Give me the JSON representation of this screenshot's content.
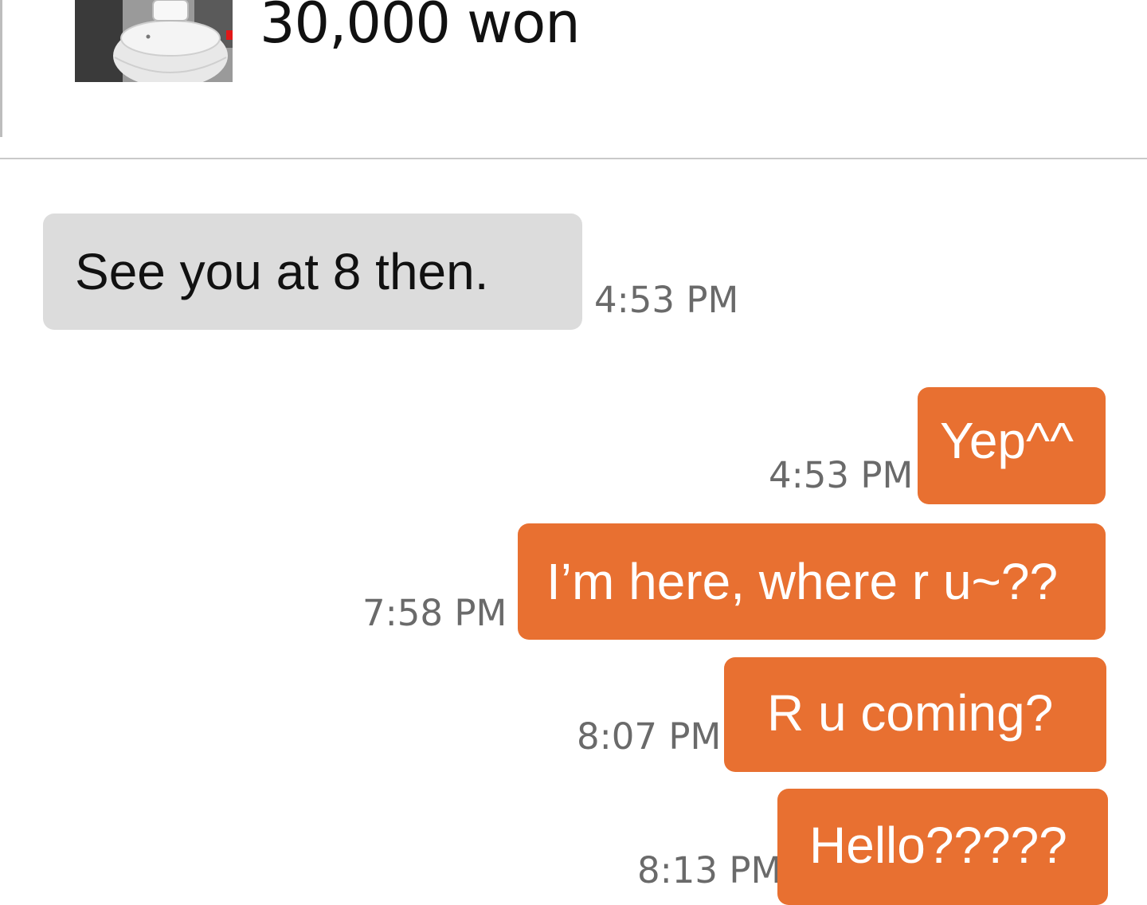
{
  "listing": {
    "price": "30,000 won",
    "thumbnail_icon": "rice-cooker-photo"
  },
  "messages": [
    {
      "direction": "incoming",
      "text": "See you at 8 then.",
      "time": "4:53 PM"
    },
    {
      "direction": "outgoing",
      "text": "Yep^^",
      "time": "4:53 PM"
    },
    {
      "direction": "outgoing",
      "text": "I’m here, where r u~??",
      "time": "7:58 PM"
    },
    {
      "direction": "outgoing",
      "text": "R u coming?",
      "time": "8:07 PM"
    },
    {
      "direction": "outgoing",
      "text": "Hello?????",
      "time": "8:13 PM"
    }
  ],
  "colors": {
    "outgoing_bubble": "#e87031",
    "incoming_bubble": "#dcdcdc"
  }
}
